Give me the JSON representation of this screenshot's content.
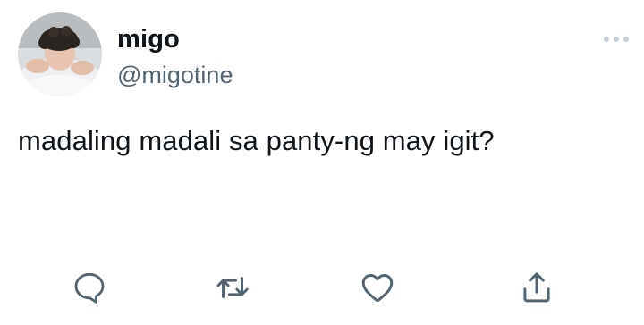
{
  "tweet": {
    "author": {
      "display_name": "migo",
      "handle": "@migotine"
    },
    "text": "madaling madali sa panty-ng may igit?"
  },
  "actions": {
    "reply_icon": "reply-icon",
    "retweet_icon": "retweet-icon",
    "like_icon": "heart-icon",
    "share_icon": "share-icon",
    "more_icon": "more-horizontal-icon"
  },
  "colors": {
    "text": "#0f1419",
    "secondary": "#536471",
    "icon": "#536471",
    "icon_light": "#c4cfd6"
  }
}
